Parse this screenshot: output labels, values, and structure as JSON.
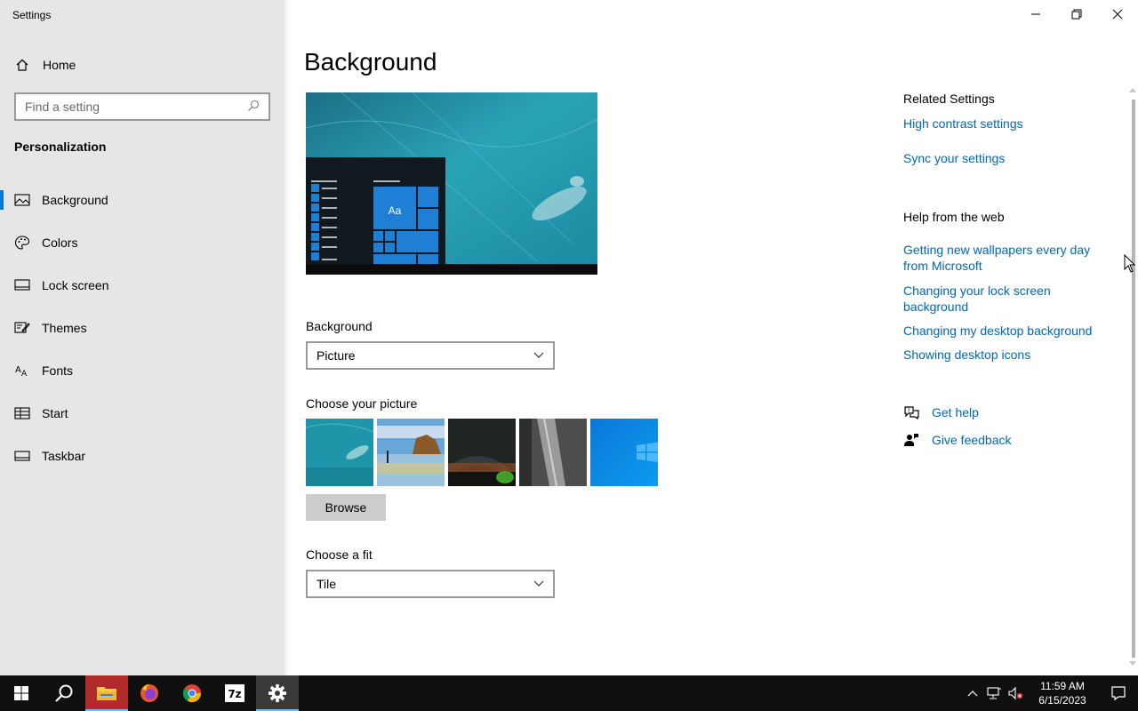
{
  "window": {
    "title": "Settings"
  },
  "nav": {
    "home_label": "Home",
    "search_placeholder": "Find a setting",
    "section_title": "Personalization",
    "items": [
      {
        "label": "Background",
        "icon": "picture-icon",
        "active": true
      },
      {
        "label": "Colors",
        "icon": "palette-icon"
      },
      {
        "label": "Lock screen",
        "icon": "lock-screen-icon"
      },
      {
        "label": "Themes",
        "icon": "themes-icon"
      },
      {
        "label": "Fonts",
        "icon": "fonts-icon"
      },
      {
        "label": "Start",
        "icon": "start-icon"
      },
      {
        "label": "Taskbar",
        "icon": "taskbar-icon"
      }
    ]
  },
  "main": {
    "title": "Background",
    "preview_tile_text": "Aa",
    "background_label": "Background",
    "background_value": "Picture",
    "choose_picture_label": "Choose your picture",
    "browse_label": "Browse",
    "choose_fit_label": "Choose a fit",
    "fit_value": "Tile"
  },
  "related": {
    "heading": "Related Settings",
    "links": [
      "High contrast settings",
      "Sync your settings"
    ]
  },
  "help_web": {
    "heading": "Help from the web",
    "links": [
      "Getting new wallpapers every day from Microsoft",
      "Changing your lock screen background",
      "Changing my desktop background",
      "Showing desktop icons"
    ]
  },
  "help_actions": {
    "get_help": "Get help",
    "give_feedback": "Give feedback"
  },
  "taskbar": {
    "time": "11:59 AM",
    "date": "6/15/2023",
    "apps": [
      "start-icon",
      "search-icon",
      "file-explorer-icon",
      "firefox-icon",
      "chrome-icon",
      "7zip-icon",
      "settings-icon"
    ]
  },
  "colors": {
    "accent": "#0078d7",
    "link": "#0067b8",
    "nav_bg": "#e6e6e6",
    "taskbar_bg": "#101010"
  }
}
